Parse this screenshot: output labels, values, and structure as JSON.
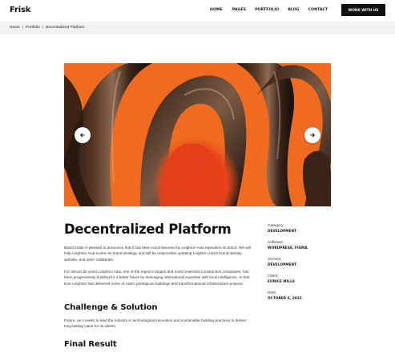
{
  "header": {
    "logo": "Frisk",
    "nav": [
      "HOME",
      "PAGES",
      "PORTFOLIO",
      "BLOG",
      "CONTACT"
    ],
    "cta": "WORK WITH US"
  },
  "breadcrumb": [
    "Home",
    "Portfolio",
    "Decentralized Platform"
  ],
  "hero": {
    "background_color": "#f06b1f",
    "accent_colors": [
      "#3a2418",
      "#e8521c"
    ],
    "prev_icon": "arrow-left-icon",
    "next_icon": "arrow-right-icon"
  },
  "article": {
    "title": "Decentralized Platform",
    "intro": "BaseCreate is pleased to announce that it has been commissioned by Leighton Asia reposition its brand. We will help Leighton Asia evolve its brand strategy, and will be responsible updating Leighton Asia's brand identity, website, and other collaterals.",
    "history": "For almost 50 years Leighton Asia, one of the region's largest and most respected construction companies, has been progressively building for a better future by leveraging international expertise with local intelligence. In that time Leighton has delivered some of Asia's prestigious buildings and transformational infrastructure projects.",
    "challenge_heading": "Challenge & Solution",
    "challenge_text": "Future, as it seeks to lead the industry in technological innovation and sustainable building practices to deliver long-lasting value for its clients.",
    "result_heading": "Final Result"
  },
  "meta": [
    {
      "label": "Category:",
      "value": "DEVELOPMENT"
    },
    {
      "label": "Software:",
      "value": "WORDPRESS, FIGMA"
    },
    {
      "label": "Service:",
      "value": "DEVELOPMENT"
    },
    {
      "label": "Client:",
      "value": "EUNICE MILLS"
    },
    {
      "label": "Date:",
      "value": "OCTOBER 6, 2022"
    }
  ]
}
